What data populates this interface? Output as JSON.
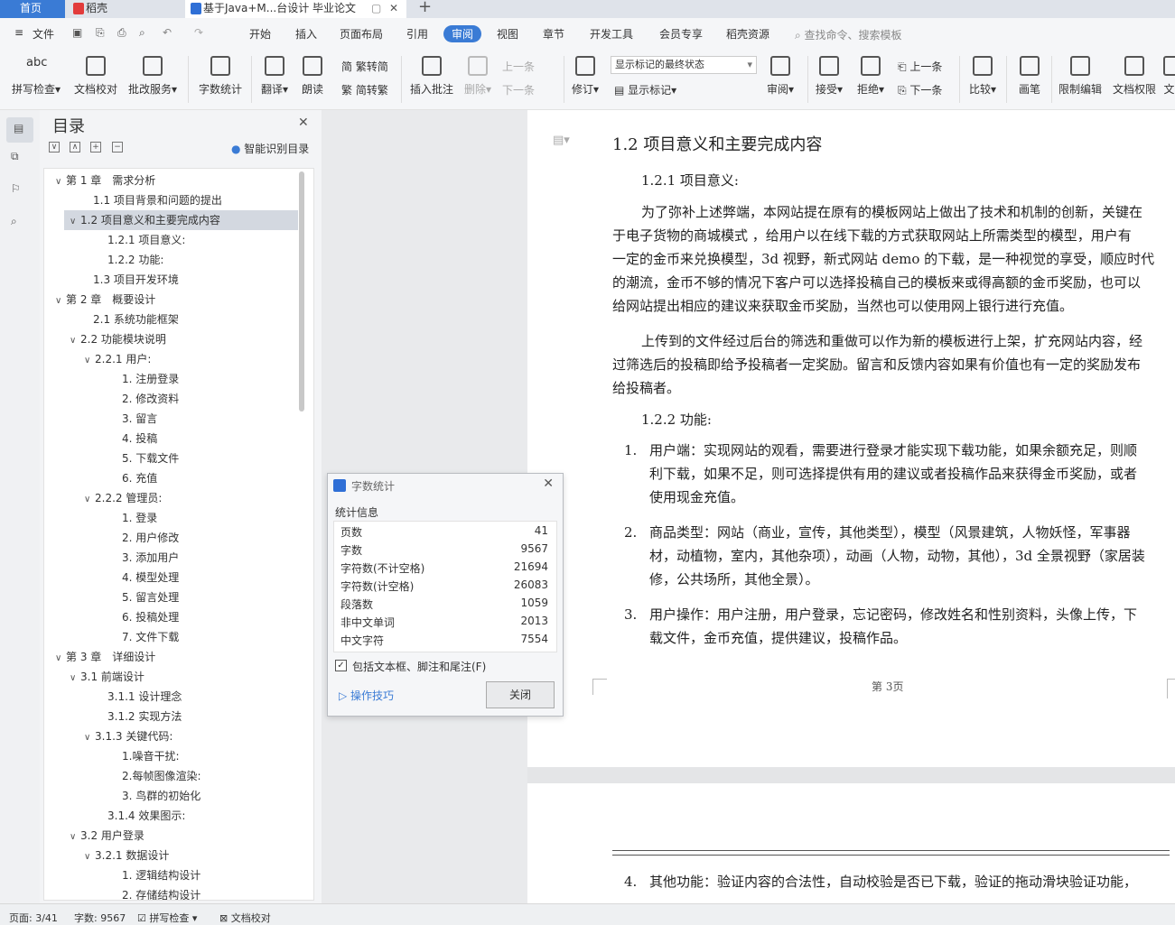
{
  "tabs": {
    "home": "首页",
    "daoke": "稻壳",
    "doc": "基于Java+M...台设计 毕业论文"
  },
  "menu": {
    "file": "文件",
    "items": [
      "开始",
      "插入",
      "页面布局",
      "引用",
      "审阅",
      "视图",
      "章节",
      "开发工具",
      "会员专享",
      "稻壳资源"
    ],
    "search": "查找命令、搜索模板"
  },
  "ribbon": {
    "spell": "拼写检查",
    "proof": "文档校对",
    "approve": "批改服务",
    "wordcount": "字数统计",
    "translate": "翻译",
    "read": "朗读",
    "trad": "繁转简",
    "simp": "简转繁",
    "insert_comment": "插入批注",
    "delete": "删除",
    "prev_comment": "上一条",
    "next_comment": "下一条",
    "revise": "修订",
    "track_state": "显示标记的最终状态",
    "show_marks": "显示标记",
    "review": "审阅",
    "accept": "接受",
    "reject": "拒绝",
    "prev": "上一条",
    "next": "下一条",
    "compare": "比较",
    "pen": "画笔",
    "restrict": "限制编辑",
    "perm": "文档权限",
    "more": "文"
  },
  "toc": {
    "title": "目录",
    "smart": "智能识别目录",
    "items": [
      {
        "t": "第 1 章　需求分析",
        "lvl": 0,
        "arrow": "∨"
      },
      {
        "t": "1.1  项目背景和问题的提出",
        "lvl": 1
      },
      {
        "t": "1.2  项目意义和主要完成内容",
        "lvl": 0.5,
        "arrow": "∨",
        "sel": true
      },
      {
        "t": "1.2.1 项目意义:",
        "lvl": 2
      },
      {
        "t": "1.2.2 功能:",
        "lvl": 2
      },
      {
        "t": "1.3  项目开发环境",
        "lvl": 1
      },
      {
        "t": "第 2 章　概要设计",
        "lvl": 0,
        "arrow": "∨"
      },
      {
        "t": "2.1 系统功能框架",
        "lvl": 1
      },
      {
        "t": "2.2 功能模块说明",
        "lvl": 0.5,
        "arrow": "∨"
      },
      {
        "t": "2.2.1 用户:",
        "lvl": 1.5,
        "arrow": "∨"
      },
      {
        "t": "1.  注册登录",
        "lvl": 3
      },
      {
        "t": "2.  修改资料",
        "lvl": 3
      },
      {
        "t": "3.  留言",
        "lvl": 3
      },
      {
        "t": "4.  投稿",
        "lvl": 3
      },
      {
        "t": "5.  下载文件",
        "lvl": 3
      },
      {
        "t": "6.  充值",
        "lvl": 3
      },
      {
        "t": "2.2.2 管理员:",
        "lvl": 1.5,
        "arrow": "∨"
      },
      {
        "t": "1.  登录",
        "lvl": 3
      },
      {
        "t": "2.  用户修改",
        "lvl": 3
      },
      {
        "t": "3.  添加用户",
        "lvl": 3
      },
      {
        "t": "4.  模型处理",
        "lvl": 3
      },
      {
        "t": "5.  留言处理",
        "lvl": 3
      },
      {
        "t": "6.  投稿处理",
        "lvl": 3
      },
      {
        "t": "7.  文件下载",
        "lvl": 3
      },
      {
        "t": "第 3 章　详细设计",
        "lvl": 0,
        "arrow": "∨"
      },
      {
        "t": "3.1 前端设计",
        "lvl": 0.5,
        "arrow": "∨"
      },
      {
        "t": "3.1.1 设计理念",
        "lvl": 2
      },
      {
        "t": "3.1.2 实现方法",
        "lvl": 2
      },
      {
        "t": "3.1.3 关键代码:",
        "lvl": 1.5,
        "arrow": "∨"
      },
      {
        "t": "1.噪音干扰:",
        "lvl": 3
      },
      {
        "t": "2.每帧图像渲染:",
        "lvl": 3
      },
      {
        "t": "3.  鸟群的初始化",
        "lvl": 3
      },
      {
        "t": "3.1.4 效果图示:",
        "lvl": 2
      },
      {
        "t": "3.2 用户登录",
        "lvl": 0.5,
        "arrow": "∨"
      },
      {
        "t": "3.2.1 数据设计",
        "lvl": 1.5,
        "arrow": "∨"
      },
      {
        "t": "1.  逻辑结构设计",
        "lvl": 3
      },
      {
        "t": "2.  存储结构设计",
        "lvl": 3
      }
    ]
  },
  "doc": {
    "heading": "1.2  项目意义和主要完成内容",
    "sub1": "1.2.1 项目意义:",
    "p1": [
      "为了弥补上述弊端，本网站提在原有的模板网站上做出了技术和机制的创新，关键在",
      "于电子货物的商城模式 ，给用户以在线下载的方式获取网站上所需类型的模型，用户有",
      "一定的金币来兑换模型，3d 视野，新式网站 demo 的下载，是一种视觉的享受，顺应时代",
      "的潮流，金币不够的情况下客户可以选择投稿自己的模板来或得高额的金币奖励，也可以",
      "给网站提出相应的建议来获取金币奖励，当然也可以使用网上银行进行充值。"
    ],
    "p2": [
      "上传到的文件经过后台的筛选和重做可以作为新的模板进行上架，扩充网站内容，经",
      "过筛选后的投稿即给予投稿者一定奖励。留言和反馈内容如果有价值也有一定的奖励发布",
      "给投稿者。"
    ],
    "sub2": "1.2.2 功能:",
    "list": [
      {
        "n": "1.",
        "lines": [
          "用户端：实现网站的观看，需要进行登录才能实现下载功能，如果余额充足，则顺",
          "利下载，如果不足，则可选择提供有用的建议或者投稿作品来获得金币奖励，或者",
          "使用现金充值。"
        ]
      },
      {
        "n": "2.",
        "lines": [
          "商品类型：网站（商业，宣传，其他类型），模型（风景建筑，人物妖怪，军事器",
          "材，动植物，室内，其他杂项），动画（人物，动物，其他），3d 全景视野（家居装",
          "修，公共场所，其他全景）。"
        ]
      },
      {
        "n": "3.",
        "lines": [
          "用户操作：用户注册，用户登录，忘记密码，修改姓名和性别资料，头像上传，下",
          "载文件，金币充值，提供建议，投稿作品。"
        ]
      }
    ],
    "footer": "第 3页",
    "p4n": "4.",
    "p4": "其他功能：验证内容的合法性，自动校验是否已下载，验证的拖动滑块验证功能，"
  },
  "dialog": {
    "title": "字数统计",
    "section": "统计信息",
    "rows": [
      [
        "页数",
        "41"
      ],
      [
        "字数",
        "9567"
      ],
      [
        "字符数(不计空格)",
        "21694"
      ],
      [
        "字符数(计空格)",
        "26083"
      ],
      [
        "段落数",
        "1059"
      ],
      [
        "非中文单词",
        "2013"
      ],
      [
        "中文字符",
        "7554"
      ]
    ],
    "checkbox": "包括文本框、脚注和尾注(F)",
    "tips": "操作技巧",
    "close": "关闭"
  },
  "status": {
    "page": "页面: 3/41",
    "words": "字数: 9567",
    "spell": "拼写检查",
    "proof": "文档校对"
  },
  "colors": {
    "accent": "#3a7bd5",
    "selected_toc": "#d3d8e0"
  }
}
